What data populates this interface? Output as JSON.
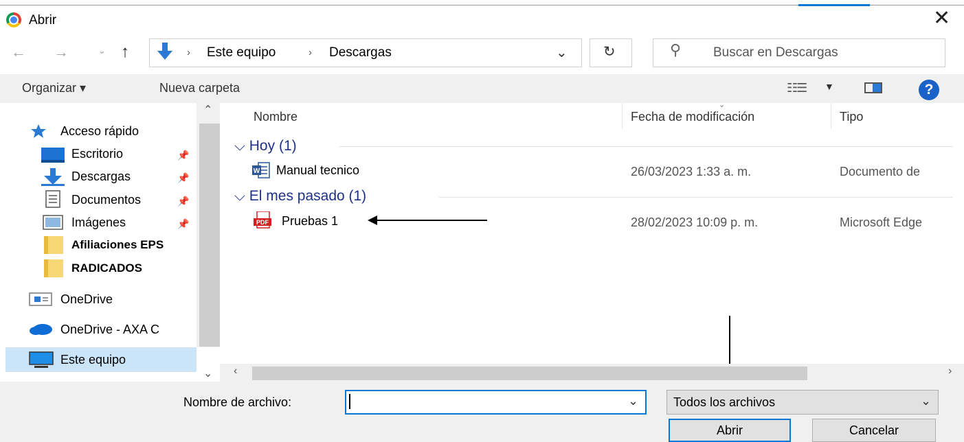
{
  "window": {
    "title": "Abrir",
    "close_glyph": "✕"
  },
  "nav": {
    "back_glyph": "←",
    "forward_glyph": "→",
    "recent_glyph": "⌄",
    "up_glyph": "↑",
    "address": [
      "Este equipo",
      "Descargas"
    ],
    "address_separator": "›",
    "address_dropdown_glyph": "⌄",
    "refresh_glyph": "↻",
    "search_placeholder": "Buscar en Descargas"
  },
  "toolbar": {
    "organize_label": "Organizar ▾",
    "new_folder_label": "Nueva carpeta",
    "help_label": "?"
  },
  "sidebar": {
    "items": [
      {
        "label": "Acceso rápido",
        "icon": "star-icon",
        "pinned": false
      },
      {
        "label": "Escritorio",
        "icon": "desktop-icon",
        "pinned": true
      },
      {
        "label": "Descargas",
        "icon": "download-icon",
        "pinned": true
      },
      {
        "label": "Documentos",
        "icon": "documents-icon",
        "pinned": true
      },
      {
        "label": "Imágenes",
        "icon": "images-icon",
        "pinned": true
      },
      {
        "label": "Afiliaciones EPS",
        "icon": "folder-icon",
        "pinned": false
      },
      {
        "label": "RADICADOS",
        "icon": "folder-icon",
        "pinned": false
      },
      {
        "label": "OneDrive",
        "icon": "onedrive-icon",
        "pinned": false
      },
      {
        "label": "OneDrive - AXA C",
        "icon": "cloud-icon",
        "pinned": false
      },
      {
        "label": "Este equipo",
        "icon": "computer-icon",
        "pinned": false,
        "selected": true
      }
    ]
  },
  "columns": {
    "name": "Nombre",
    "date": "Fecha de modificación",
    "type": "Tipo"
  },
  "groups": [
    {
      "label": "Hoy (1)",
      "files": [
        {
          "name": "Manual tecnico",
          "date": "26/03/2023 1:33 a. m.",
          "type": "Documento de",
          "icon": "word-doc-icon"
        }
      ]
    },
    {
      "label": "El mes pasado (1)",
      "files": [
        {
          "name": "Pruebas 1",
          "date": "28/02/2023 10:09 p. m.",
          "type": "Microsoft Edge",
          "icon": "pdf-icon"
        }
      ]
    }
  ],
  "pdf_badge": "PDF",
  "footer": {
    "filename_label": "Nombre de archivo:",
    "filename_value": "",
    "filetype_value": "Todos los archivos",
    "open_label": "Abrir",
    "cancel_label": "Cancelar"
  },
  "colors": {
    "accent": "#0078d7",
    "group_header": "#1e3287",
    "selection": "#cce4f7"
  }
}
